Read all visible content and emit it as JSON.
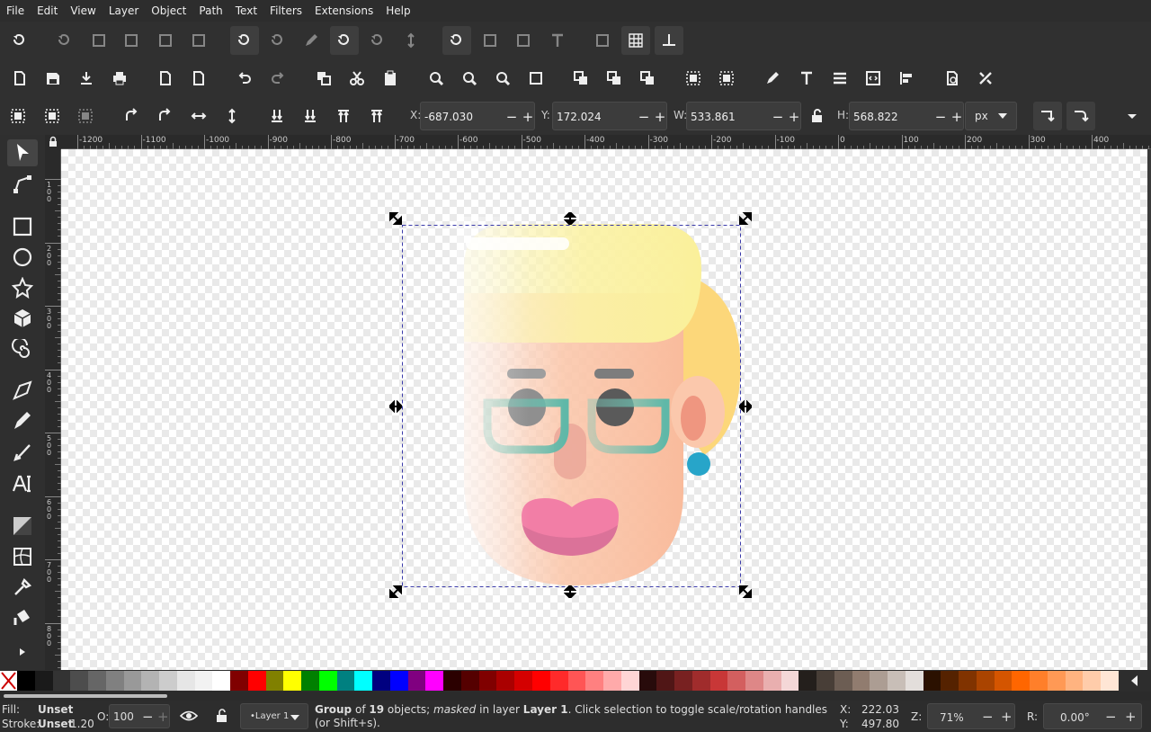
{
  "menu": [
    "File",
    "Edit",
    "View",
    "Layer",
    "Object",
    "Path",
    "Text",
    "Filters",
    "Extensions",
    "Help"
  ],
  "toolbar": {
    "x_label": "X:",
    "x_value": "-687.030",
    "y_label": "Y:",
    "y_value": "172.024",
    "w_label": "W:",
    "w_value": "533.861",
    "h_label": "H:",
    "h_value": "568.822",
    "unit": "px"
  },
  "ruler": {
    "top_labels": [
      "-1200",
      "-1100",
      "-1000",
      "-900",
      "-800",
      "-700",
      "-600",
      "-500",
      "-400",
      "-300",
      "-200",
      "-100",
      "0",
      "100",
      "200",
      "300",
      "400"
    ],
    "left_labels": [
      "100",
      "200",
      "300",
      "400",
      "500",
      "600",
      "700",
      "800"
    ]
  },
  "palette": {
    "colors": [
      "#000000",
      "#1a1a1a",
      "#333333",
      "#4d4d4d",
      "#666666",
      "#808080",
      "#999999",
      "#b3b3b3",
      "#cccccc",
      "#e6e6e6",
      "#f2f2f2",
      "#ffffff",
      "#800000",
      "#ff0000",
      "#808000",
      "#ffff00",
      "#008000",
      "#00ff00",
      "#008080",
      "#00ffff",
      "#000080",
      "#0000ff",
      "#800080",
      "#ff00ff",
      "#2b0000",
      "#550000",
      "#800000",
      "#aa0000",
      "#d40000",
      "#ff0000",
      "#ff2a2a",
      "#ff5555",
      "#ff8080",
      "#ffaaaa",
      "#ffd5d5",
      "#280b0b",
      "#501616",
      "#782121",
      "#a02c2c",
      "#c83737",
      "#d35f5f",
      "#de8787",
      "#e9afaf",
      "#f4d7d7",
      "#241f1c",
      "#483e37",
      "#6c5d53",
      "#917c6f",
      "#ac9d93",
      "#c8beb7",
      "#e3dedb",
      "#2b1100",
      "#552200",
      "#803300",
      "#aa4400",
      "#d45500",
      "#ff6600",
      "#ff7f2a",
      "#ff9955",
      "#ffb380",
      "#ffccaa",
      "#ffe6d5"
    ]
  },
  "status": {
    "fill_label": "Fill:",
    "fill_value": "Unset",
    "stroke_label": "Stroke:",
    "stroke_value": "Unset",
    "stroke_width": "1.20",
    "opacity_label": "O:",
    "opacity_value": "100",
    "layer": "•Layer 1",
    "msg_group": "Group",
    "msg_of": "of",
    "msg_count": "19",
    "msg_objects": "objects;",
    "msg_masked": "masked",
    "msg_in_layer": "in layer",
    "msg_layer": "Layer 1",
    "msg_rest": ". Click selection to toggle scale/rotation handles",
    "msg_line2": "(or Shift+s).",
    "cx_label": "X:",
    "cx_value": "222.03",
    "cy_label": "Y:",
    "cy_value": "497.80",
    "zoom_label": "Z:",
    "zoom_value": "71%",
    "rot_label": "R:",
    "rot_value": "0.00°"
  }
}
